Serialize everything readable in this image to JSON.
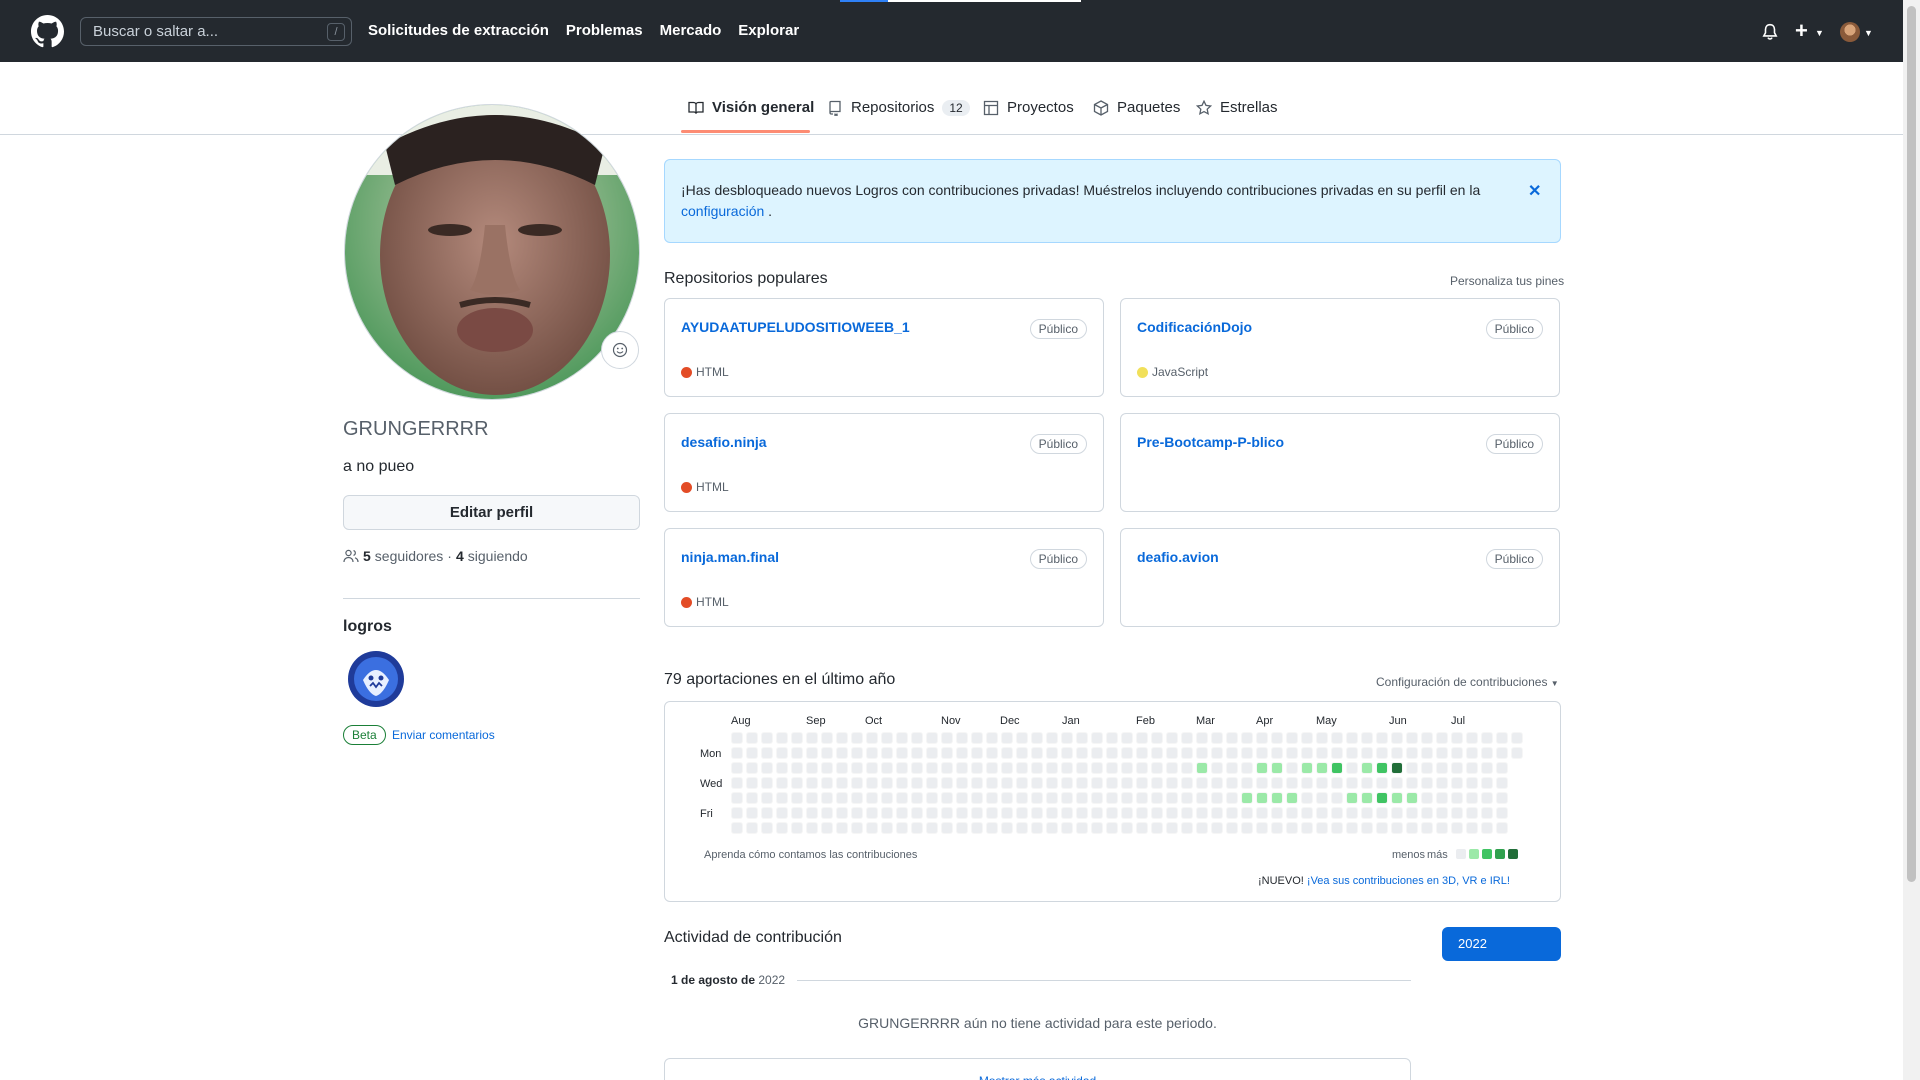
{
  "header": {
    "search_placeholder": "Buscar o saltar a...",
    "search_shortcut": "/",
    "nav": [
      "Solicitudes de extracción",
      "Problemas",
      "Mercado",
      "Explorar"
    ]
  },
  "tabs": [
    {
      "label": "Visión general",
      "active": true,
      "icon": "book-icon"
    },
    {
      "label": "Repositorios",
      "count": "12",
      "icon": "repo-icon"
    },
    {
      "label": "Proyectos",
      "icon": "table-icon"
    },
    {
      "label": "Paquetes",
      "icon": "package-icon"
    },
    {
      "label": "Estrellas",
      "icon": "star-icon"
    }
  ],
  "profile": {
    "username": "GRUNGERRRR",
    "bio": "a no pueo",
    "edit_label": "Editar perfil",
    "followers_count": "5",
    "followers_label": "seguidores",
    "following_count": "4",
    "following_label": "siguiendo",
    "achievements_title": "logros",
    "beta_label": "Beta",
    "feedback_label": "Enviar comentarios"
  },
  "alert": {
    "text": "¡Has desbloqueado nuevos Logros con contribuciones privadas! Muéstrelos incluyendo contribuciones privadas en su perfil en la",
    "link": "configuración",
    "suffix": "."
  },
  "popular": {
    "title": "Repositorios populares",
    "customize": "Personaliza tus pines",
    "repos": [
      {
        "name": "AYUDAATUPELUDOSITIOWEEB_1",
        "visibility": "Público",
        "language": "HTML",
        "lang_color": "#e34c26"
      },
      {
        "name": "CodificaciónDojo",
        "visibility": "Público",
        "language": "JavaScript",
        "lang_color": "#f1e05a"
      },
      {
        "name": "desafio.ninja",
        "visibility": "Público",
        "language": "HTML",
        "lang_color": "#e34c26"
      },
      {
        "name": "Pre-Bootcamp-P-blico",
        "visibility": "Público",
        "language": "",
        "lang_color": ""
      },
      {
        "name": "ninja.man.final",
        "visibility": "Público",
        "language": "HTML",
        "lang_color": "#e34c26"
      },
      {
        "name": "deafio.avion",
        "visibility": "Público",
        "language": "",
        "lang_color": ""
      }
    ]
  },
  "contributions": {
    "title": "79 aportaciones en el último año",
    "settings": "Configuración de contribuciones",
    "months": [
      "Aug",
      "Sep",
      "Oct",
      "Nov",
      "Dec",
      "Jan",
      "Feb",
      "Mar",
      "Apr",
      "May",
      "Jun",
      "Jul"
    ],
    "days": [
      "Mon",
      "Wed",
      "Fri"
    ],
    "learn": "Aprenda cómo contamos las contribuciones",
    "less": "menos",
    "more": "más",
    "new_label": "¡NUEVO!",
    "new_link": "¡Vea sus contribuciones en 3D, VR e IRL!",
    "level_colors": [
      "#ebedf0",
      "#9be9a8",
      "#40c463",
      "#30a14e",
      "#216e39"
    ],
    "active_cells": [
      {
        "week": 31,
        "day": 2,
        "level": 1
      },
      {
        "week": 35,
        "day": 2,
        "level": 1
      },
      {
        "week": 36,
        "day": 2,
        "level": 1
      },
      {
        "week": 38,
        "day": 2,
        "level": 1
      },
      {
        "week": 39,
        "day": 2,
        "level": 1
      },
      {
        "week": 40,
        "day": 2,
        "level": 2
      },
      {
        "week": 42,
        "day": 2,
        "level": 1
      },
      {
        "week": 43,
        "day": 2,
        "level": 2
      },
      {
        "week": 44,
        "day": 2,
        "level": 4
      },
      {
        "week": 34,
        "day": 4,
        "level": 1
      },
      {
        "week": 35,
        "day": 4,
        "level": 1
      },
      {
        "week": 36,
        "day": 4,
        "level": 1
      },
      {
        "week": 37,
        "day": 4,
        "level": 1
      },
      {
        "week": 41,
        "day": 4,
        "level": 1
      },
      {
        "week": 42,
        "day": 4,
        "level": 1
      },
      {
        "week": 43,
        "day": 4,
        "level": 2
      },
      {
        "week": 44,
        "day": 4,
        "level": 1
      },
      {
        "week": 45,
        "day": 4,
        "level": 1
      }
    ]
  },
  "activity": {
    "title": "Actividad de contribución",
    "year": "2022",
    "date_label": "1 de agosto de",
    "date_year": "2022",
    "empty": "GRUNGERRRR aún no tiene actividad para este periodo.",
    "more": "Mostrar más actividad"
  }
}
